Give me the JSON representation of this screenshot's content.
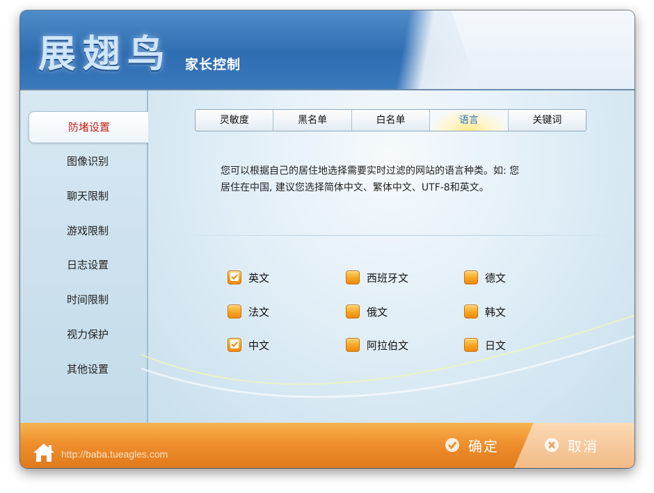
{
  "header": {
    "logo": "展翅鸟",
    "subtitle": "家长控制"
  },
  "sidebar": {
    "items": [
      {
        "label": "防堵设置",
        "active": true
      },
      {
        "label": "图像识别"
      },
      {
        "label": "聊天限制"
      },
      {
        "label": "游戏限制"
      },
      {
        "label": "日志设置"
      },
      {
        "label": "时间限制"
      },
      {
        "label": "视力保护"
      },
      {
        "label": "其他设置"
      }
    ]
  },
  "tabs": [
    {
      "label": "灵敏度"
    },
    {
      "label": "黑名单"
    },
    {
      "label": "白名单"
    },
    {
      "label": "语言",
      "active": true
    },
    {
      "label": "关键词"
    }
  ],
  "description": {
    "line1": "您可以根据自己的居住地选择需要实时过滤的网站的语言种类。如: 您",
    "line2": "居住在中国, 建议您选择简体中文、繁体中文、UTF-8和英文。"
  },
  "languages": [
    {
      "label": "英文",
      "checked": true
    },
    {
      "label": "西班牙文",
      "checked": false
    },
    {
      "label": "德文",
      "checked": false
    },
    {
      "label": "法文",
      "checked": false
    },
    {
      "label": "俄文",
      "checked": false
    },
    {
      "label": "韩文",
      "checked": false
    },
    {
      "label": "中文",
      "checked": true
    },
    {
      "label": "阿拉伯文",
      "checked": false
    },
    {
      "label": "日文",
      "checked": false
    }
  ],
  "footer": {
    "url": "http://baba.tueagles.com",
    "confirm_label": "确定",
    "cancel_label": "取消"
  },
  "colors": {
    "accent_blue": "#2f6db2",
    "active_red": "#c0201a",
    "footer_orange": "#ef8f2d",
    "checkbox_orange": "#f6a21d"
  }
}
